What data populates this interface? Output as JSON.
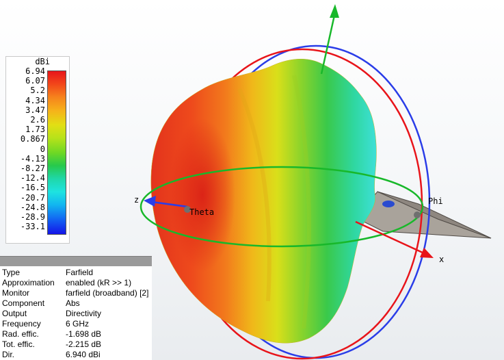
{
  "legend": {
    "unit": "dBi",
    "ticks": [
      "6.94",
      "6.07",
      "5.2",
      "4.34",
      "3.47",
      "2.6",
      "1.73",
      "0.867",
      "0",
      "-4.13",
      "-8.27",
      "-12.4",
      "-16.5",
      "-20.7",
      "-24.8",
      "-28.9",
      "-33.1"
    ]
  },
  "info": {
    "rows": [
      {
        "key": "Type",
        "value": "Farfield"
      },
      {
        "key": "Approximation",
        "value": "enabled (kR >> 1)"
      },
      {
        "key": "Monitor",
        "value": "farfield (broadband) [2]"
      },
      {
        "key": "Component",
        "value": "Abs"
      },
      {
        "key": "Output",
        "value": "Directivity"
      },
      {
        "key": "Frequency",
        "value": "6 GHz"
      },
      {
        "key": "Rad. effic.",
        "value": "-1.698 dB"
      },
      {
        "key": "Tot. effic.",
        "value": "-2.215 dB"
      },
      {
        "key": "Dir.",
        "value": "6.940 dBi"
      }
    ]
  },
  "axes": {
    "x_label": "x",
    "z_label": "z",
    "theta_label": "Theta",
    "phi_label": "Phi"
  },
  "colors": {
    "x_axis": "#e8141a",
    "y_axis": "#18b82a",
    "z_axis": "#2a3de8",
    "ring_red": "#e8141a",
    "ring_blue": "#2a3de8",
    "ring_green": "#18b82a"
  }
}
